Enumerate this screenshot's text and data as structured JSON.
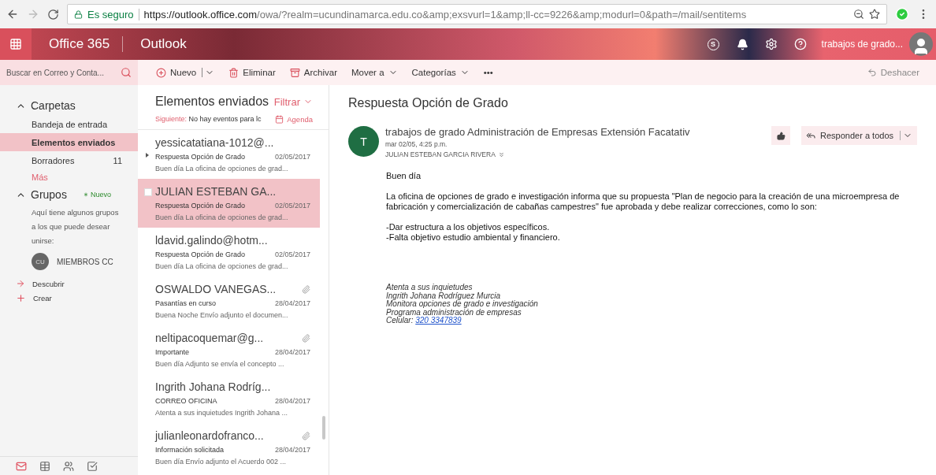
{
  "browser": {
    "secure_label": "Es seguro",
    "url_host": "https://outlook.office.com",
    "url_path": "/owa/?realm=ucundinamarca.edu.co&amp;exsvurl=1&amp;ll-cc=9226&amp;modurl=0&path=/mail/sentitems"
  },
  "header": {
    "skype": "S",
    "suite": "Office 365",
    "app": "Outlook",
    "user": "trabajos de grado..."
  },
  "search": {
    "placeholder": "Buscar en Correo y Conta..."
  },
  "toolbar": [
    {
      "label": "Nuevo",
      "kind": "new"
    },
    {
      "label": "Eliminar",
      "kind": "delete"
    },
    {
      "label": "Archivar",
      "kind": "archive"
    },
    {
      "label": "Mover a",
      "kind": "menu"
    },
    {
      "label": "Categorías",
      "kind": "menu"
    },
    {
      "label": "•••",
      "kind": "more"
    }
  ],
  "undo": "Deshacer",
  "nav": {
    "folders_title": "Carpetas",
    "folders_expanded": true,
    "folders": [
      {
        "name": "Bandeja de entrada",
        "selected": false
      },
      {
        "name": "Elementos enviados",
        "selected": true
      },
      {
        "name": "Borradores",
        "count": "11",
        "selected": false
      }
    ],
    "more": "Más",
    "groups_title": "Grupos",
    "groups_expanded": true,
    "new_badge": "Nuevo",
    "groups_hint": "Aquí tiene algunos grupos a los que puede desear unirse:",
    "group": {
      "initials": "CU",
      "name": "MIEMBROS CC"
    },
    "actions": [
      {
        "label": "Descubrir",
        "kind": "discover"
      },
      {
        "label": "Crear",
        "kind": "create"
      }
    ],
    "apps": [
      {
        "kind": "mail",
        "selected": true
      },
      {
        "kind": "calendar",
        "selected": false
      },
      {
        "kind": "people",
        "selected": false
      },
      {
        "kind": "tasks",
        "selected": false
      }
    ]
  },
  "list": {
    "title": "Elementos enviados",
    "filter": "Filtrar",
    "next_label": "Siguiente:",
    "next_text": "No hay eventos para lc",
    "agenda": "Agenda",
    "items": [
      {
        "sender": "yessicatatiana-1012@...",
        "subject": "Respuesta Opción de Grado",
        "date": "02/05/2017",
        "preview": "Buen día  La oficina de opciones de grad...",
        "attachment": false,
        "thread": true,
        "selected": false
      },
      {
        "sender": "JULIAN ESTEBAN GA...",
        "subject": "Respuesta Opción de Grado",
        "date": "02/05/2017",
        "preview": "Buen día  La oficina de opciones de grad...",
        "attachment": false,
        "thread": false,
        "selected": true
      },
      {
        "sender": "ldavid.galindo@hotm...",
        "subject": "Respuesta Opción de Grado",
        "date": "02/05/2017",
        "preview": "Buen día  La oficina de opciones de grad...",
        "attachment": false,
        "thread": false,
        "selected": false
      },
      {
        "sender": "OSWALDO VANEGAS...",
        "subject": "Pasantías en curso",
        "date": "28/04/2017",
        "preview": "Buena Noche   Envío adjunto el documen...",
        "attachment": true,
        "thread": false,
        "selected": false
      },
      {
        "sender": "neltipacoquemar@g...",
        "subject": "Importante",
        "date": "28/04/2017",
        "preview": "Buen día    Adjunto se envía el concepto ...",
        "attachment": true,
        "thread": false,
        "selected": false
      },
      {
        "sender": "Ingrith Johana Rodríg...",
        "subject": "CORREO OFICINA",
        "date": "28/04/2017",
        "preview": "Atenta a sus inquietudes  Ingrith Johana ...",
        "attachment": false,
        "thread": false,
        "selected": false
      },
      {
        "sender": "julianleonardofranco...",
        "subject": "Información solicitada",
        "date": "28/04/2017",
        "preview": "Buen día   Envío adjunto el Acuerdo 002 ...",
        "attachment": true,
        "thread": false,
        "selected": false
      }
    ]
  },
  "message": {
    "subject": "Respuesta Opción de Grado",
    "avatar": "T",
    "from": "trabajos de grado Administración de Empresas Extensión Facatativ",
    "date": "mar 02/05, 4:25 p.m.",
    "to": "JULIAN ESTEBAN GARCIA RIVERA",
    "reply_all": "Responder a todos",
    "greeting": "Buen día",
    "paragraph": "La oficina de opciones de grado e investigación informa que su propuesta \"Plan de negocio para la creación de una microempresa de fabricación y comercialización de cabañas campestres\" fue aprobada y debe realizar correcciones, como lo son:",
    "points": [
      "-Dar estructura a los objetivos específicos.",
      "-Falta objetivo estudio ambiental y financiero."
    ],
    "signature": [
      "Atenta a sus inquietudes",
      "Ingrith Johana Rodríguez Murcia",
      "Monitora opciones de grado e investigación",
      "Programa administración de empresas"
    ],
    "phone_label": "Celular:",
    "phone": "320 3347839"
  }
}
